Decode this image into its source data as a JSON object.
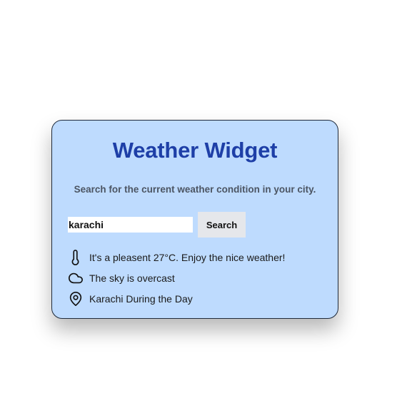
{
  "widget": {
    "title": "Weather Widget",
    "subtitle": "Search for the current weather condition in your city."
  },
  "search": {
    "value": "karachi",
    "button_label": "Search"
  },
  "info": [
    {
      "icon": "thermometer-icon",
      "text": "It's a pleasent 27°C. Enjoy the nice weather!"
    },
    {
      "icon": "cloud-icon",
      "text": "The sky is overcast"
    },
    {
      "icon": "map-pin-icon",
      "text": "Karachi During the Day"
    }
  ],
  "colors": {
    "card_background": "#bedbfe",
    "title": "#1e3fa7",
    "subtitle": "#4c5563",
    "button_background": "#e5e7eb"
  }
}
